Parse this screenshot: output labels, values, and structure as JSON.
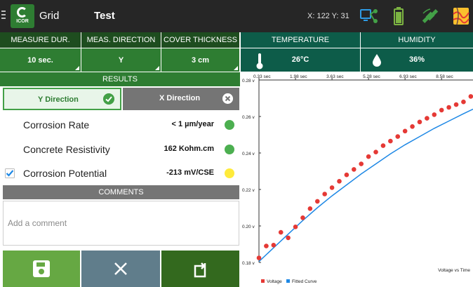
{
  "header": {
    "app_title": "Grid",
    "logo_text": "ICOR",
    "test_title": "Test",
    "coords": "X: 122 Y: 31",
    "icons": [
      "menu-icon",
      "app-logo",
      "network-icon",
      "battery-icon",
      "satellite-icon",
      "map-icon"
    ]
  },
  "params": {
    "measure_duration": {
      "label": "MEASURE DUR.",
      "value": "10 sec."
    },
    "direction": {
      "label": "MEAS. DIRECTION",
      "value": "Y"
    },
    "cover": {
      "label": "COVER THICKNESS",
      "value": "3 cm"
    }
  },
  "environment": {
    "temperature": {
      "label": "TEMPERATURE",
      "value": "26°C"
    },
    "humidity": {
      "label": "HUMIDITY",
      "value": "36%"
    }
  },
  "results": {
    "title": "RESULTS",
    "tabs": [
      {
        "label": "Y Direction",
        "state": "selected"
      },
      {
        "label": "X Direction",
        "state": "unselected"
      }
    ],
    "rows": [
      {
        "name": "Corrosion Rate",
        "value": "< 1 µm/year",
        "status_color": "#4caf50",
        "checked": null
      },
      {
        "name": "Concrete Resistivity",
        "value": "162 Kohm.cm",
        "status_color": "#4caf50",
        "checked": null
      },
      {
        "name": "Corrosion Potential",
        "value": "-213 mV/CSE",
        "status_color": "#ffeb3b",
        "checked": true
      }
    ]
  },
  "comments": {
    "title": "COMMENTS",
    "placeholder": "Add a comment",
    "value": ""
  },
  "actions": {
    "save": {
      "icon": "save-icon"
    },
    "cancel": {
      "icon": "close-icon"
    },
    "redo": {
      "icon": "redo-icon"
    }
  },
  "colors": {
    "accent_green": "#2e7d32",
    "teal": "#0d5c49",
    "status_green": "#4caf50",
    "status_yellow": "#ffeb3b",
    "voltage_points": "#e53935",
    "fitted_curve": "#1e88e5"
  },
  "chart_data": {
    "type": "scatter",
    "title": "Voltage vs Time",
    "x_ticks": [
      "0.33 sec",
      "1.98 sec",
      "3.63 sec",
      "5.28 sec",
      "6.93 sec",
      "8.58 sec"
    ],
    "y_ticks": [
      "0.18 v",
      "0.20 v",
      "0.22 v",
      "0.24 v",
      "0.26 v",
      "0.28 v"
    ],
    "xlim": [
      0.33,
      10.0
    ],
    "ylim": [
      0.18,
      0.28
    ],
    "legend": [
      {
        "name": "Voltage",
        "color": "#e53935"
      },
      {
        "name": "Fitted Curve",
        "color": "#1e88e5"
      }
    ],
    "legend_position": "bottom-left",
    "series": [
      {
        "name": "Voltage",
        "x": [
          0.33,
          0.66,
          0.99,
          1.32,
          1.65,
          1.98,
          2.31,
          2.64,
          2.97,
          3.3,
          3.63,
          3.96,
          4.29,
          4.62,
          4.95,
          5.28,
          5.61,
          5.94,
          6.27,
          6.6,
          6.93,
          7.26,
          7.59,
          7.92,
          8.25,
          8.58,
          8.91,
          9.24,
          9.57,
          9.9
        ],
        "y": [
          0.1825,
          0.189,
          0.1895,
          0.1965,
          0.1935,
          0.1995,
          0.2045,
          0.2095,
          0.2135,
          0.2175,
          0.221,
          0.2245,
          0.228,
          0.231,
          0.234,
          0.238,
          0.2405,
          0.244,
          0.2465,
          0.249,
          0.252,
          0.2545,
          0.257,
          0.259,
          0.261,
          0.2635,
          0.265,
          0.2665,
          0.268,
          0.271
        ]
      },
      {
        "name": "Fitted Curve",
        "x": [
          0.33,
          0.99,
          1.65,
          2.31,
          2.97,
          3.63,
          4.29,
          4.95,
          5.61,
          6.27,
          6.93,
          7.59,
          8.25,
          8.91,
          9.57,
          10.0
        ],
        "y": [
          0.1805,
          0.188,
          0.1955,
          0.203,
          0.21,
          0.2165,
          0.2225,
          0.2285,
          0.234,
          0.2395,
          0.2445,
          0.249,
          0.2535,
          0.2575,
          0.2615,
          0.264
        ]
      }
    ]
  }
}
